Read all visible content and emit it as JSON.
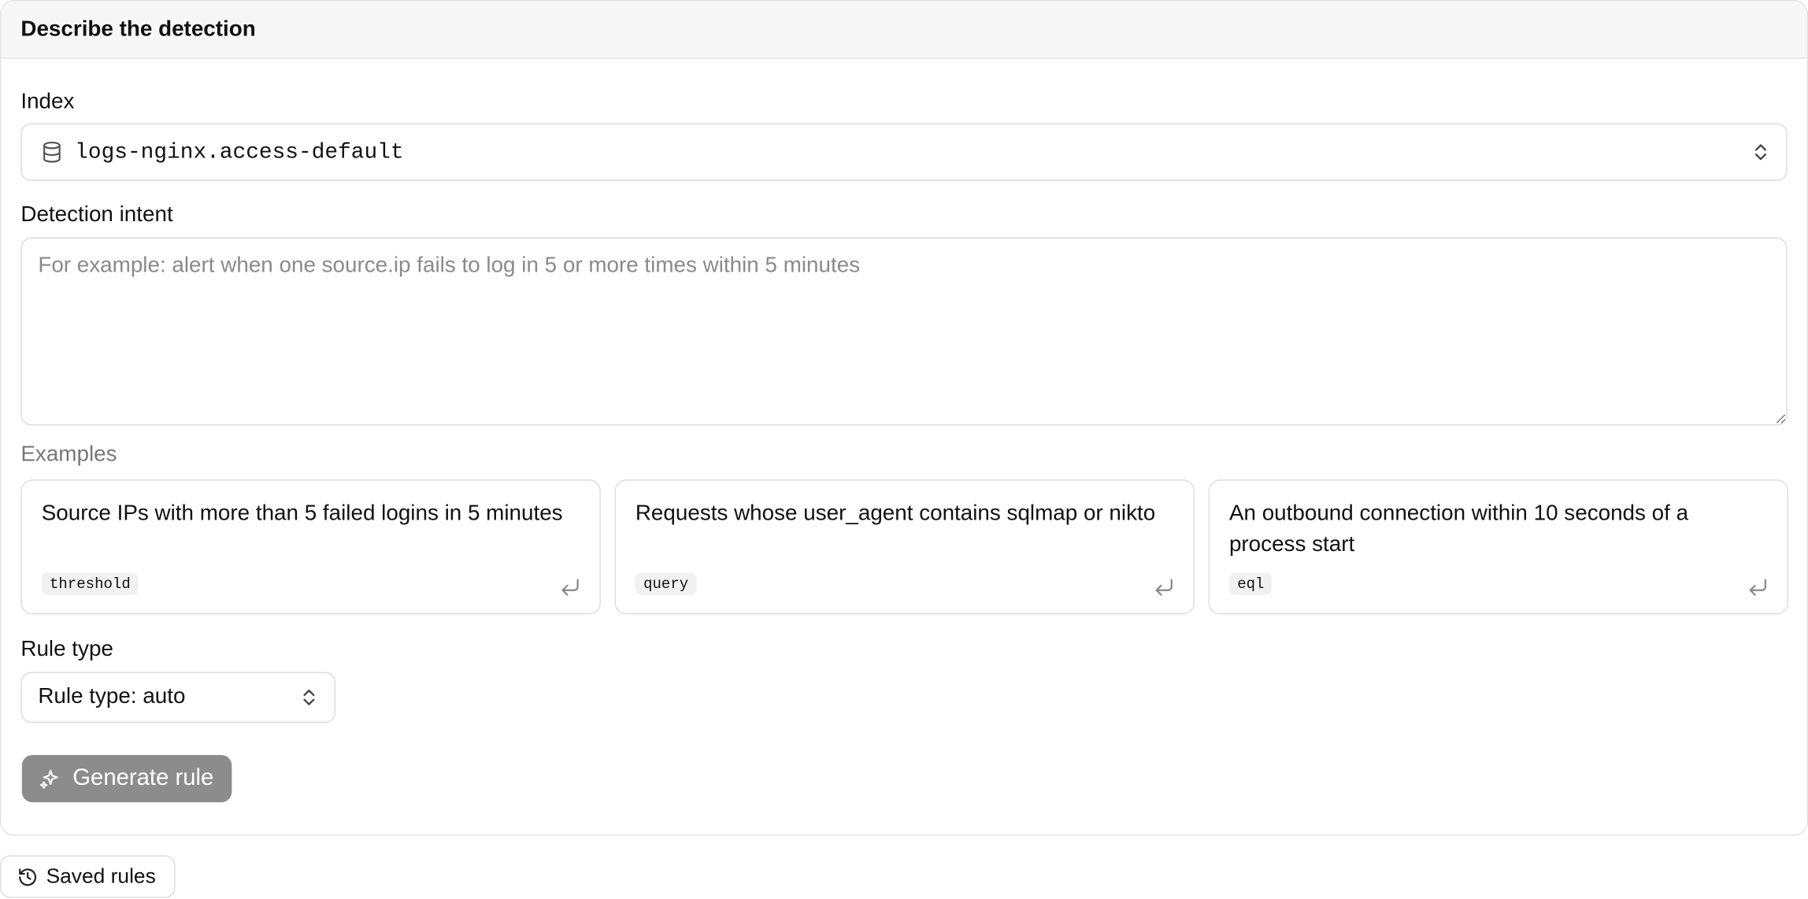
{
  "panel": {
    "title": "Describe the detection"
  },
  "index": {
    "label": "Index",
    "value": "logs-nginx.access-default",
    "icon": "database-icon"
  },
  "intent": {
    "label": "Detection intent",
    "placeholder": "For example: alert when one source.ip fails to log in 5 or more times within 5 minutes",
    "value": ""
  },
  "examples": {
    "label": "Examples",
    "items": [
      {
        "text": "Source IPs with more than 5 failed logins in 5 minutes",
        "tag": "threshold"
      },
      {
        "text": "Requests whose user_agent contains sqlmap or nikto",
        "tag": "query"
      },
      {
        "text": "An outbound connection within 10 seconds of a process start",
        "tag": "eql"
      }
    ]
  },
  "rule_type": {
    "label": "Rule type",
    "selected": "Rule type: auto"
  },
  "generate": {
    "label": "Generate rule",
    "icon": "sparkle-icon"
  },
  "saved": {
    "label": "Saved rules",
    "icon": "history-icon"
  },
  "colors": {
    "button_disabled": "#8c8c8c",
    "border": "#dcdcdc",
    "header_bg": "#f7f7f7"
  }
}
